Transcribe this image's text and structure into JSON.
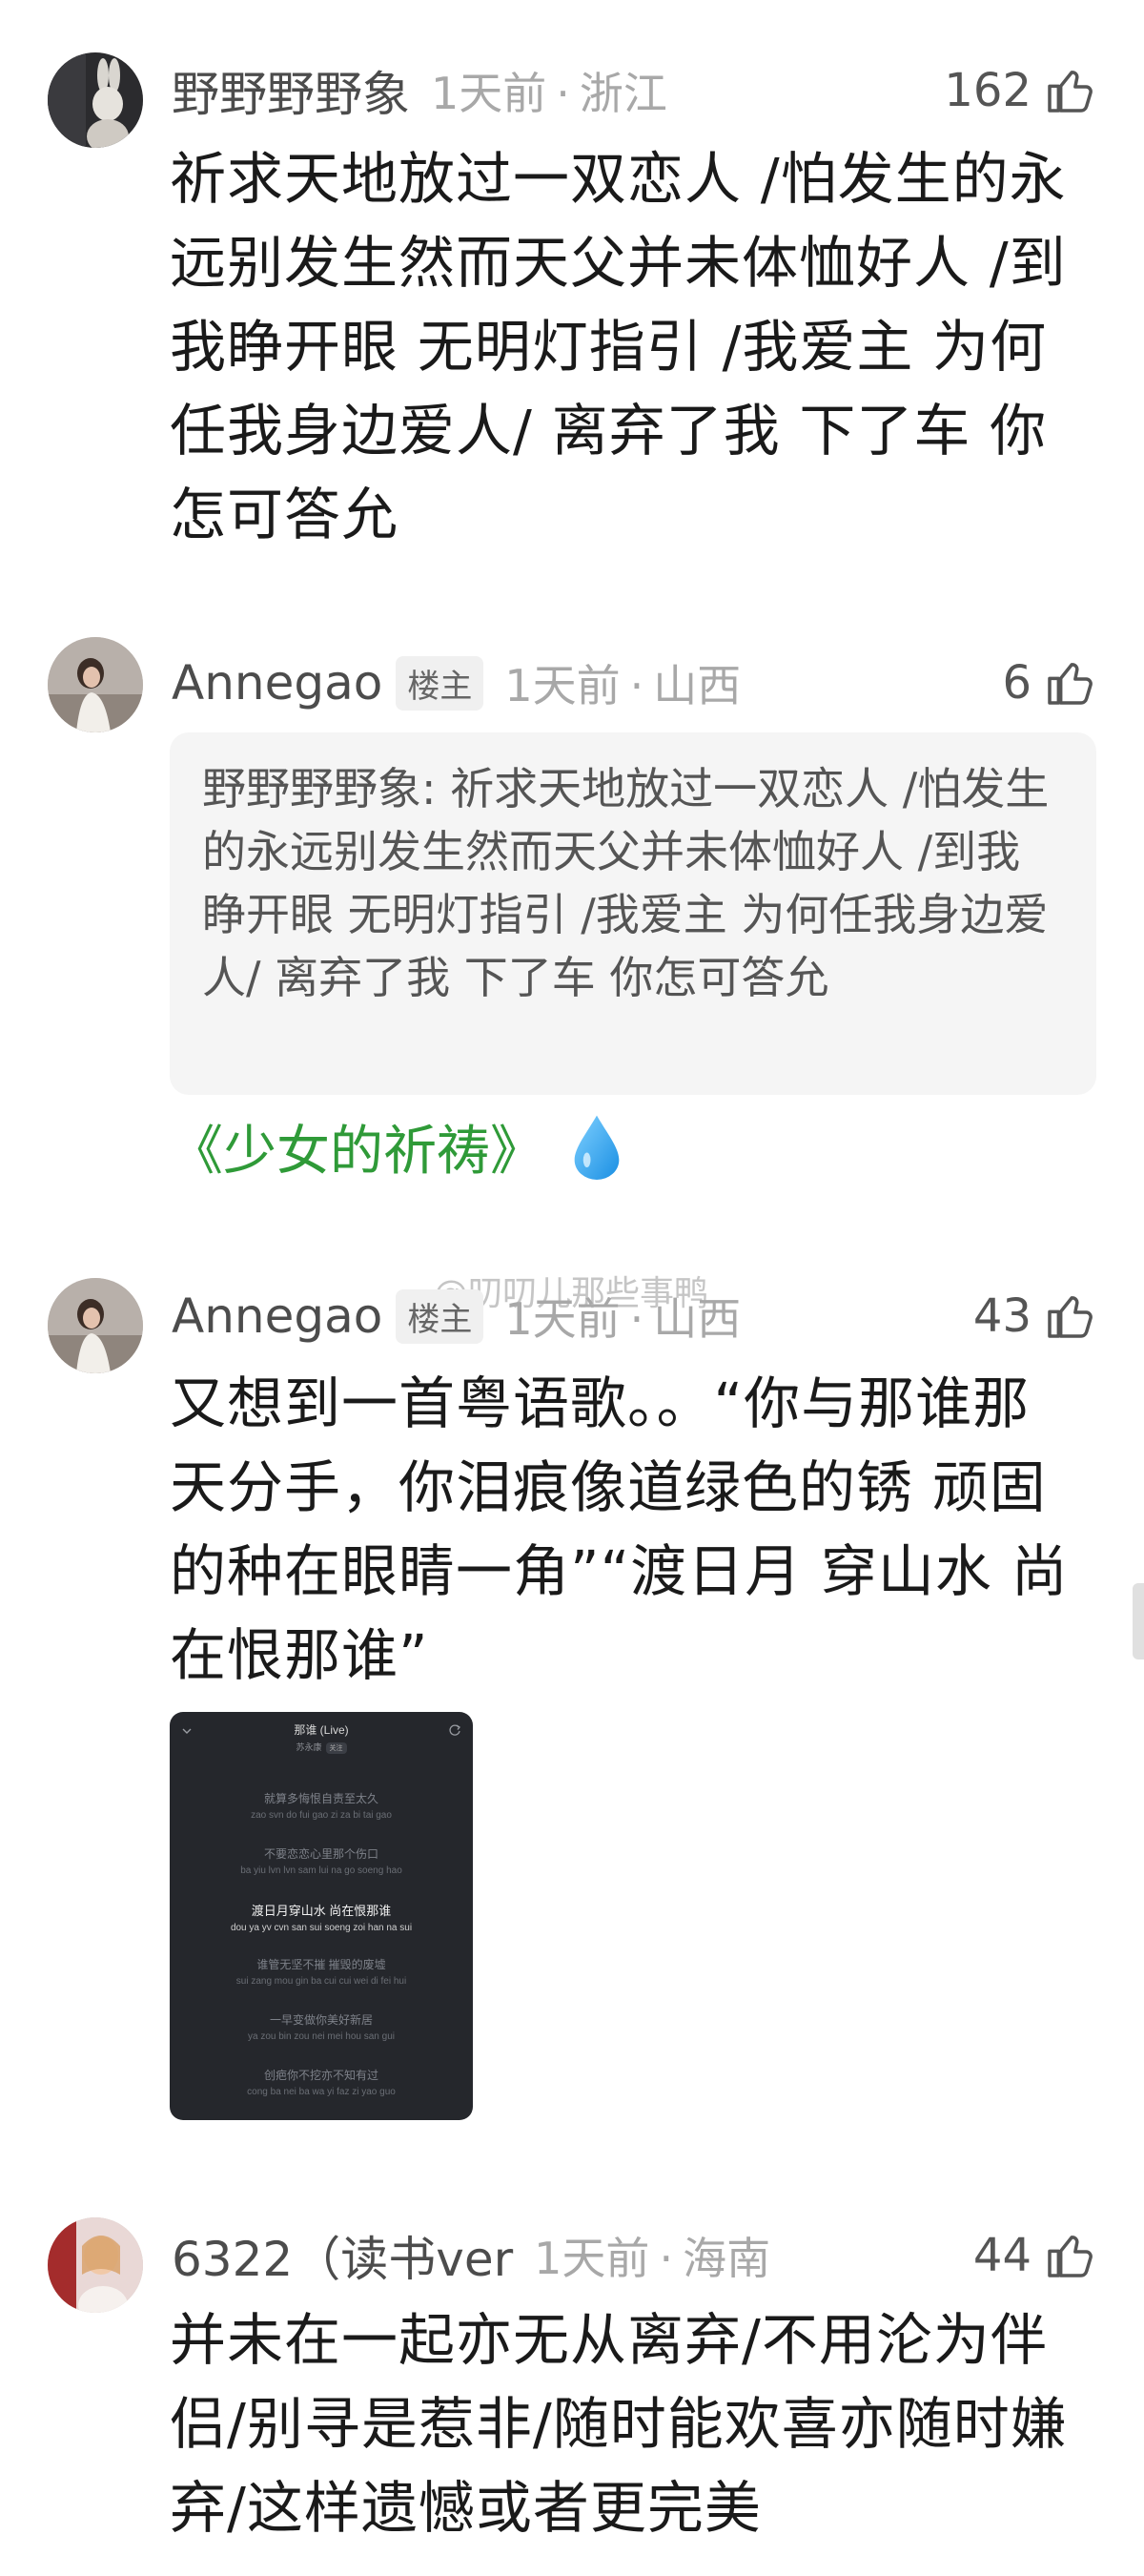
{
  "comments": [
    {
      "username": "野野野野象",
      "time": "1天前",
      "location": "浙江",
      "likes": "162",
      "text": "祈求天地放过一双恋人 /怕发生的永远别发生然而天父并未体恤好人 /到我睁开眼 无明灯指引 /我爱主 为何任我身边爱人/ 离弃了我 下了车 你怎可答允"
    },
    {
      "username": "Annegao",
      "badge": "楼主",
      "time": "1天前",
      "location": "山西",
      "likes": "6",
      "quote": "野野野野象: 祈求天地放过一双恋人 /怕发生的永远别发生然而天父并未体恤好人 /到我睁开眼 无明灯指引 /我爱主 为何任我身边爱人/ 离弃了我 下了车 你怎可答允",
      "song_link": "《少女的祈祷》",
      "emoji_icon": "droplet-icon"
    },
    {
      "username": "Annegao",
      "badge": "楼主",
      "time": "1天前",
      "location": "山西",
      "likes": "43",
      "text": "又想到一首粤语歌。。“你与那谁那天分手，你泪痕像道绿色的锈 顽固的种在眼睛一角”“渡日月 穿山水 尚在恨那谁”",
      "attachment": {
        "title": "那谁 (Live)",
        "artist": "苏永康",
        "follow": "关注",
        "lines": [
          {
            "cn": "就算多悔恨自责至太久",
            "py": "zao svn do fui gao zi za bi tai gao"
          },
          {
            "cn": "不要恋恋心里那个伤口",
            "py": "ba yiu lvn lvn sam lui na go soeng hao"
          },
          {
            "cn": "渡日月穿山水 尚在恨那谁",
            "py": "dou ya yv cvn san sui soeng zoi han na sui"
          },
          {
            "cn": "谁管无坚不摧 摧毁的废墟",
            "py": "sui zang mou gin ba cui cui wei di fei hui"
          },
          {
            "cn": "一早变做你美好新居",
            "py": "ya zou bin zou nei mei hou san gui"
          },
          {
            "cn": "创疤你不挖亦不知有过",
            "py": "cong ba nei ba wa yi faz zi yao guo"
          }
        ]
      }
    },
    {
      "username": "6322（读书ver",
      "time": "1天前",
      "location": "海南",
      "likes": "44",
      "text": "并未在一起亦无从离弃/不用沦为伴侣/别寻是惹非/随时能欢喜亦随时嫌弃/这样遗憾或者更完美"
    }
  ],
  "watermark": "@叨叨儿那些事鸭",
  "colors": {
    "link_green": "#2f9a38",
    "meta_gray": "#a8a8a8",
    "quote_bg": "#f5f5f5"
  }
}
